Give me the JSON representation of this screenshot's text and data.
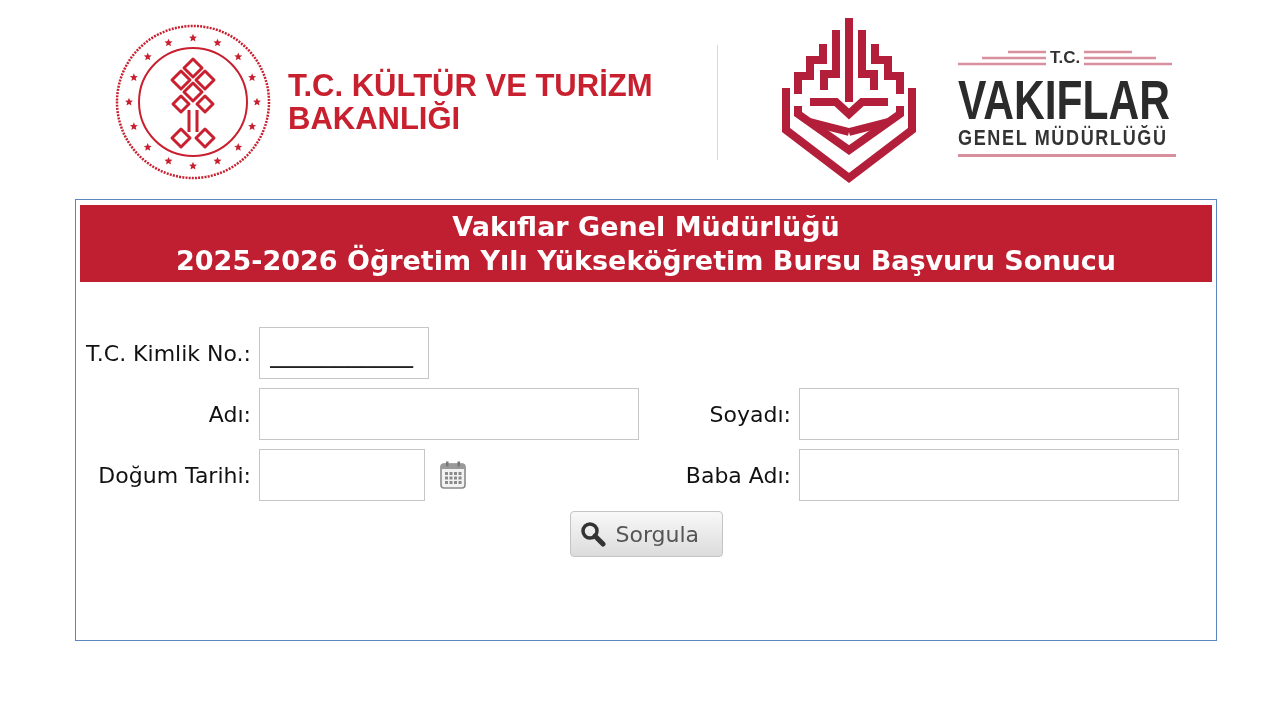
{
  "logos": {
    "ministry": {
      "lines": [
        "T.C. KÜLTÜR VE TURİZM",
        "BAKANLIĞI"
      ]
    },
    "foundations": {
      "prefix": "T.C.",
      "name": "VAKIFLAR",
      "subtitle": "GENEL MÜDÜRLÜĞÜ"
    }
  },
  "form": {
    "title_lines": [
      "Vakıflar Genel Müdürlüğü",
      "2025-2026 Öğretim Yılı Yükseköğretim Bursu Başvuru Sonucu"
    ],
    "rows": [
      {
        "fields": [
          {
            "kind": "id",
            "label": "T.C. Kimlik No.:",
            "value": "___________"
          }
        ]
      },
      {
        "fields": [
          {
            "kind": "text",
            "label": "Adı:"
          },
          {
            "kind": "text",
            "label": "Soyadı:"
          }
        ]
      },
      {
        "fields": [
          {
            "kind": "date",
            "label": "Doğum Tarihi:"
          },
          {
            "kind": "text",
            "label": "Baba Adı:"
          }
        ]
      }
    ],
    "button": {
      "label": "Sorgula"
    }
  }
}
